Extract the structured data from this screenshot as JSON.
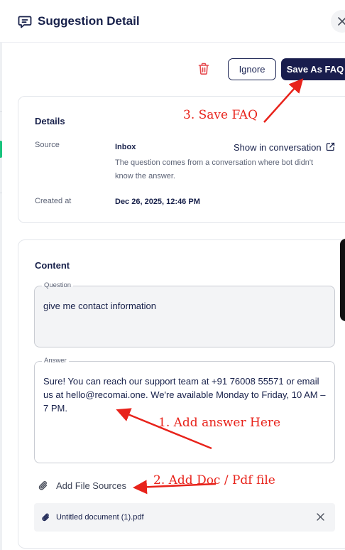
{
  "header": {
    "title": "Suggestion Detail"
  },
  "toolbar": {
    "ignore_label": "Ignore",
    "save_label": "Save As FAQ"
  },
  "details": {
    "title": "Details",
    "source_label": "Source",
    "source_value": "Inbox",
    "show_conversation": "Show in conversation",
    "description": "The question comes from a conversation where bot didn't know the answer.",
    "created_label": "Created at",
    "created_value": "Dec 26, 2025, 12:46 PM"
  },
  "content": {
    "title": "Content",
    "question_label": "Question",
    "question_value": "give me contact information",
    "answer_label": "Answer",
    "answer_value": "Sure! You can reach our support team at +91 76008 55571 or email us at hello@recomai.one. We're available Monday to Friday, 10 AM – 7 PM.",
    "add_sources_label": "Add File Sources",
    "files": [
      {
        "name": "Untitled document (1).pdf"
      }
    ]
  },
  "annotations": {
    "step1": "1. Add answer Here",
    "step2": "2. Add Doc / Pdf file",
    "step3": "3. Save FAQ"
  },
  "colors": {
    "primary_dark": "#191d4d",
    "delete_red": "#e5484d",
    "annotation_red": "#e8231b",
    "accent_green": "#19c37d"
  },
  "icons": {
    "header": "message-square-icon",
    "close": "close-icon",
    "delete": "trash-icon",
    "external": "external-link-icon",
    "attach": "paperclip-icon"
  }
}
